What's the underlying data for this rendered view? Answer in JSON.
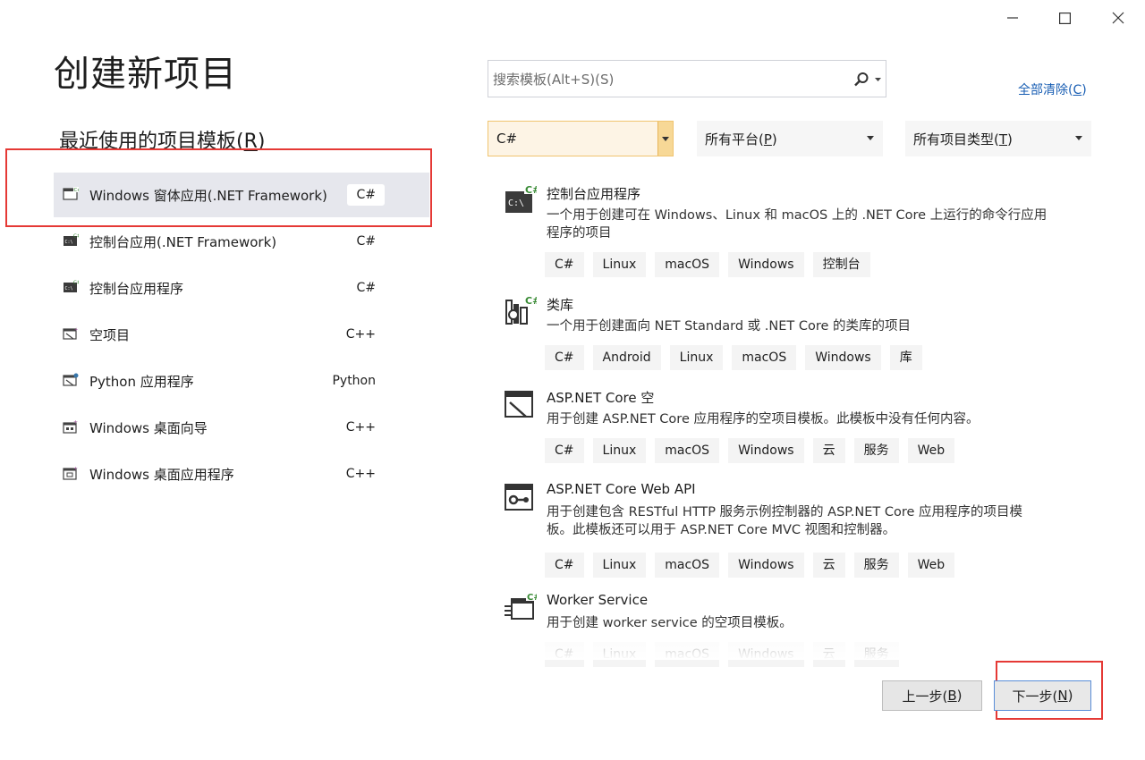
{
  "window": {
    "controls": [
      "minimize-icon",
      "maximize-icon",
      "close-icon"
    ]
  },
  "page_title": "创建新项目",
  "recent": {
    "heading_text": "最近使用的项目模板",
    "heading_accel": "R",
    "items": [
      {
        "label": "Windows 窗体应用(.NET Framework)",
        "lang": "C#",
        "icon": "winforms-icon",
        "selected": true
      },
      {
        "label": "控制台应用(.NET Framework)",
        "lang": "C#",
        "icon": "console-icon",
        "selected": false
      },
      {
        "label": "控制台应用程序",
        "lang": "C#",
        "icon": "console-icon",
        "selected": false
      },
      {
        "label": "空项目",
        "lang": "C++",
        "icon": "empty-project-icon",
        "selected": false
      },
      {
        "label": "Python 应用程序",
        "lang": "Python",
        "icon": "python-app-icon",
        "selected": false
      },
      {
        "label": "Windows 桌面向导",
        "lang": "C++",
        "icon": "desktop-wizard-icon",
        "selected": false
      },
      {
        "label": "Windows 桌面应用程序",
        "lang": "C++",
        "icon": "desktop-app-icon",
        "selected": false
      }
    ]
  },
  "search": {
    "placeholder_text": "搜索模板(Alt+S)(",
    "placeholder_accel": "S",
    "placeholder_tail": ")",
    "placeholder_full": "搜索模板(Alt+S)(S)"
  },
  "clear_all": {
    "text": "全部清除(",
    "accel": "C",
    "tail": ")"
  },
  "filters": {
    "language": {
      "value": "C#"
    },
    "platform": {
      "text": "所有平台(",
      "accel": "P",
      "tail": ")"
    },
    "project_type": {
      "text": "所有项目类型(",
      "accel": "T",
      "tail": ")"
    }
  },
  "templates": [
    {
      "name": "控制台应用程序",
      "description": "一个用于创建可在 Windows、Linux 和 macOS 上的 .NET Core 上运行的命令行应用程序的项目",
      "tags": [
        "C#",
        "Linux",
        "macOS",
        "Windows",
        "控制台"
      ],
      "icon": "console-app-icon"
    },
    {
      "name": "类库",
      "description": "一个用于创建面向 NET Standard 或 .NET Core 的类库的项目",
      "tags": [
        "C#",
        "Android",
        "Linux",
        "macOS",
        "Windows",
        "库"
      ],
      "icon": "class-library-icon"
    },
    {
      "name": "ASP.NET Core 空",
      "description": "用于创建 ASP.NET Core 应用程序的空项目模板。此模板中没有任何内容。",
      "tags": [
        "C#",
        "Linux",
        "macOS",
        "Windows",
        "云",
        "服务",
        "Web"
      ],
      "icon": "aspnet-empty-icon"
    },
    {
      "name": "ASP.NET Core Web API",
      "description": "用于创建包含 RESTful HTTP 服务示例控制器的 ASP.NET Core 应用程序的项目模板。此模板还可以用于 ASP.NET Core MVC 视图和控制器。",
      "tags": [
        "C#",
        "Linux",
        "macOS",
        "Windows",
        "云",
        "服务",
        "Web"
      ],
      "icon": "web-api-icon"
    },
    {
      "name": "Worker Service",
      "description": "用于创建 worker service 的空项目模板。",
      "tags": [
        "C#",
        "Linux",
        "macOS",
        "Windows",
        "云",
        "服务"
      ],
      "icon": "worker-service-icon"
    }
  ],
  "buttons": {
    "back": {
      "text": "上一步(",
      "accel": "B",
      "tail": ")"
    },
    "next": {
      "text": "下一步(",
      "accel": "N",
      "tail": ")"
    }
  },
  "colors": {
    "highlight_box": "#e53935",
    "link": "#1a5fb4",
    "selected_row": "#e6e7ed",
    "csharp_badge": "#68a23a"
  }
}
